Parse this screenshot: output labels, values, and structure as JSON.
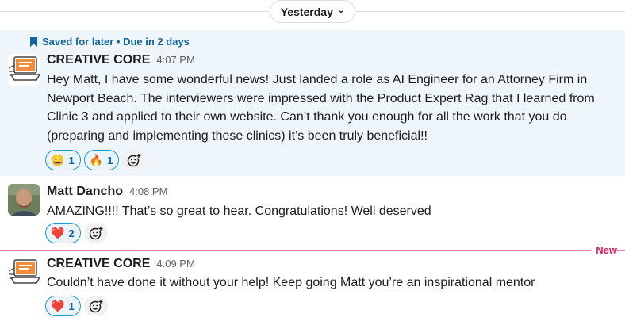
{
  "date_divider": {
    "label": "Yesterday"
  },
  "messages": [
    {
      "saved_banner": "Saved for later • Due in 2 days",
      "sender": "CREATIVE CORE",
      "time": "4:07 PM",
      "text": "Hey Matt, I have some wonderful news! Just landed a role as AI Engineer for an Attorney Firm in Newport Beach. The interviewers were impressed with the Product Expert Rag that I learned from Clinic 3 and applied to their own website. Can’t thank you enough for all the work that you do (preparing and implementing these clinics) it’s been truly beneficial!!",
      "reactions": [
        {
          "emoji": "😄",
          "count": "1"
        },
        {
          "emoji": "🔥",
          "count": "1"
        }
      ]
    },
    {
      "sender": "Matt Dancho",
      "time": "4:08 PM",
      "text": "AMAZING!!!! That’s so great to hear. Congratulations! Well deserved",
      "reactions": [
        {
          "emoji": "❤️",
          "count": "2"
        }
      ]
    },
    {
      "sender": "CREATIVE CORE",
      "time": "4:09 PM",
      "text": "Couldn’t have done it without your help! Keep going Matt you’re an inspirational mentor",
      "reactions": [
        {
          "emoji": "❤️",
          "count": "1"
        }
      ]
    }
  ],
  "new_divider": {
    "label": "New"
  },
  "colors": {
    "saved_bg": "#eef6fb",
    "link_blue": "#1264a3",
    "new_red": "#e01e5a"
  }
}
